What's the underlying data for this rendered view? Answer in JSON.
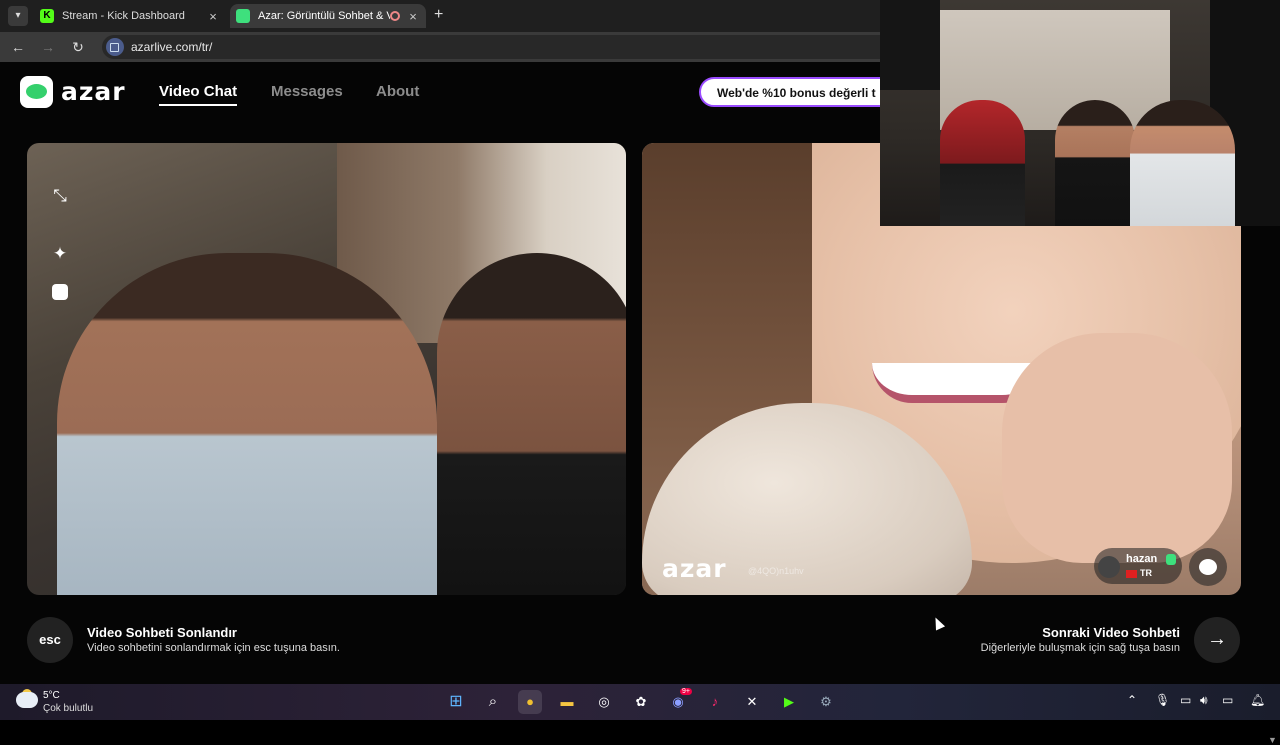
{
  "browser": {
    "tabs": [
      {
        "title": "Stream - Kick Dashboard",
        "favicon": "K"
      },
      {
        "title": "Azar: Görüntülü Sohbet & V",
        "favicon": "azar"
      }
    ],
    "new_tab": "+",
    "url": "azarlive.com/tr/"
  },
  "header": {
    "logo": "azar",
    "nav": [
      "Video Chat",
      "Messages",
      "About"
    ],
    "promo": "Web'de %10 bonus değerli t"
  },
  "left_video": {
    "tools": [
      "minimize-icon",
      "magic-wand-icon",
      "face-filter-icon"
    ]
  },
  "right_video": {
    "watermark": "azar",
    "watermark_id": "@4QO)n1uhv",
    "username": "hazan",
    "country": "TR"
  },
  "controls": {
    "esc_label": "esc",
    "end_title": "Video Sohbeti Sonlandır",
    "end_sub": "Video sohbetini sonlandırmak için esc tuşuna basın.",
    "next_title": "Sonraki Video Sohbeti",
    "next_sub": "Diğerleriyle buluşmak için sağ tuşa basın",
    "next_arrow": "→"
  },
  "taskbar": {
    "temperature": "5°C",
    "condition": "Çok bulutlu",
    "discord_badge": "9+"
  },
  "colors": {
    "brand_green": "#34d06c",
    "promo_border": "#9a4cff",
    "page_bg": "#050505"
  }
}
